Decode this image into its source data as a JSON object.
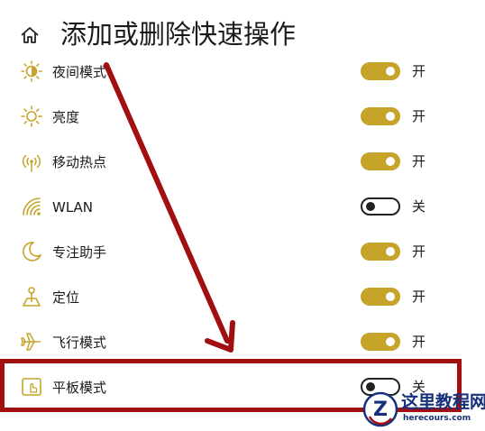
{
  "header": {
    "title": "添加或删除快速操作",
    "home_icon": "home-icon"
  },
  "accent_color": "#c6a42a",
  "highlight_color": "#a20f10",
  "items": [
    {
      "label": "夜间模式",
      "icon": "night-light-icon",
      "on": true,
      "state": "开"
    },
    {
      "label": "亮度",
      "icon": "brightness-icon",
      "on": true,
      "state": "开"
    },
    {
      "label": "移动热点",
      "icon": "hotspot-icon",
      "on": true,
      "state": "开"
    },
    {
      "label": "WLAN",
      "icon": "wifi-icon",
      "on": false,
      "state": "关"
    },
    {
      "label": "专注助手",
      "icon": "focus-assist-icon",
      "on": true,
      "state": "开"
    },
    {
      "label": "定位",
      "icon": "location-icon",
      "on": true,
      "state": "开"
    },
    {
      "label": "飞行模式",
      "icon": "airplane-icon",
      "on": true,
      "state": "开"
    },
    {
      "label": "平板模式",
      "icon": "tablet-mode-icon",
      "on": false,
      "state": "关"
    }
  ],
  "watermark": {
    "title": "这里教程网",
    "subtitle": "herecours.com"
  }
}
